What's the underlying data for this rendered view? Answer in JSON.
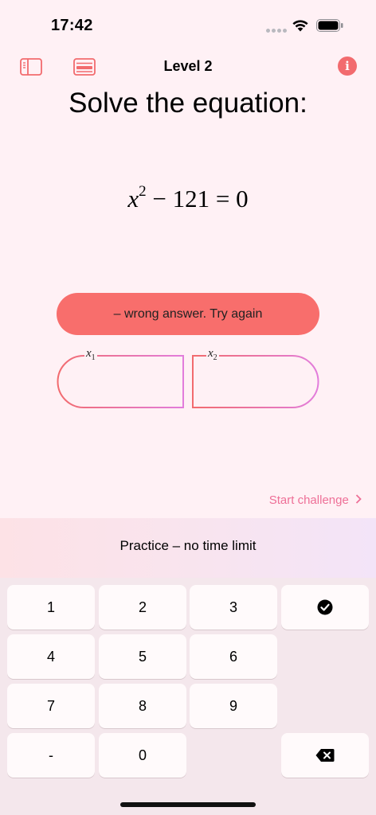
{
  "status_bar": {
    "time": "17:42"
  },
  "toolbar": {
    "title": "Level 2"
  },
  "question": {
    "prompt": "Solve the equation:",
    "equation": {
      "variable": "x",
      "exponent": "2",
      "operator": "−",
      "constant": "121",
      "equals": "=",
      "rhs": "0"
    }
  },
  "feedback": {
    "message": "– wrong answer. Try again"
  },
  "answers": [
    {
      "label_var": "x",
      "label_sub": "1",
      "value": ""
    },
    {
      "label_var": "x",
      "label_sub": "2",
      "value": ""
    }
  ],
  "challenge": {
    "label": "Start challenge"
  },
  "mode": {
    "label": "Practice – no time limit"
  },
  "keypad": {
    "k1": "1",
    "k2": "2",
    "k3": "3",
    "k4": "4",
    "k5": "5",
    "k6": "6",
    "k7": "7",
    "k8": "8",
    "k9": "9",
    "kminus": "-",
    "k0": "0"
  },
  "colors": {
    "accent": "#f26b6e",
    "banner": "#f86e6c",
    "link": "#ee6f97",
    "field_gradient_start": "#f26b6e",
    "field_gradient_end": "#e27ddc"
  }
}
